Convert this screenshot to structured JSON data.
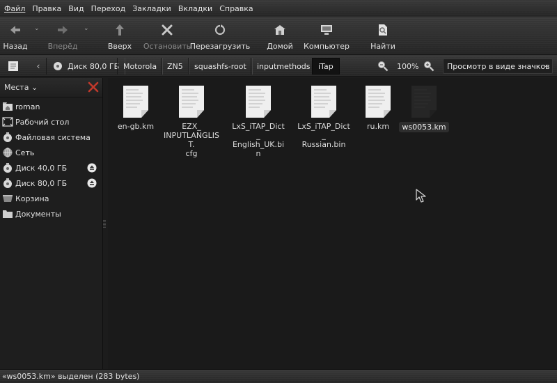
{
  "menubar": {
    "items": [
      "Файл",
      "Правка",
      "Вид",
      "Переход",
      "Закладки",
      "Вкладки",
      "Справка"
    ]
  },
  "toolbar": {
    "back": "Назад",
    "forward": "Вперёд",
    "up": "Вверх",
    "stop": "Остановить",
    "reload": "Перезагрузить",
    "home": "Домой",
    "computer": "Компьютер",
    "search": "Найти"
  },
  "location": {
    "crumbs": [
      "Диск 80,0 ГБ",
      "Motorola",
      "ZN5",
      "squashfs-root",
      "inputmethods",
      "iTap"
    ],
    "zoom": "100%",
    "view_mode": "Просмотр в виде значков"
  },
  "sidebar": {
    "title": "Места",
    "items": [
      {
        "label": "roman",
        "icon": "home-folder-icon"
      },
      {
        "label": "Рабочий стол",
        "icon": "desktop-icon"
      },
      {
        "label": "Файловая система",
        "icon": "filesystem-icon"
      },
      {
        "label": "Сеть",
        "icon": "network-icon"
      },
      {
        "label": "Диск 40,0 ГБ",
        "icon": "drive-icon"
      },
      {
        "label": "Диск 80,0 ГБ",
        "icon": "drive-icon"
      },
      {
        "label": "Корзина",
        "icon": "trash-icon"
      },
      {
        "label": "Документы",
        "icon": "folder-icon"
      }
    ]
  },
  "files": [
    {
      "name": "en-gb.km",
      "selected": false
    },
    {
      "name": "EZX_\nINPUTLANGLIST.\ncfg",
      "selected": false
    },
    {
      "name": "LxS_iTAP_Dict_\nEnglish_UK.bin",
      "selected": false
    },
    {
      "name": "LxS_iTAP_Dict_\nRussian.bin",
      "selected": false
    },
    {
      "name": "ru.km",
      "selected": false
    },
    {
      "name": "ws0053.km",
      "selected": true
    }
  ],
  "status": "«ws0053.km» выделен (283 bytes)",
  "colors": {
    "background": "#1a1a1a",
    "chrome": "#2e2e2e",
    "text": "#e0e0e0",
    "close_red": "#c0392b"
  }
}
